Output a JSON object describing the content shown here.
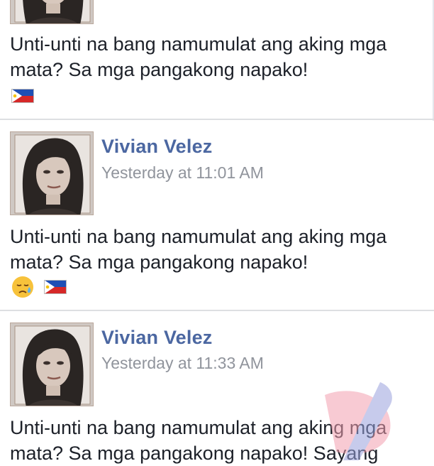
{
  "posts": [
    {
      "text": "Unti-unti na bang namumulat ang aking mga\nmata? Sa mga pangakong napako!",
      "emojis": [
        "philippines-flag"
      ]
    },
    {
      "author": "Vivian Velez",
      "timestamp": "Yesterday at 11:01 AM",
      "text": "Unti-unti na bang namumulat ang aking mga\nmata? Sa mga pangakong napako!",
      "emojis": [
        "sad-face-with-tear",
        "philippines-flag"
      ]
    },
    {
      "author": "Vivian Velez",
      "timestamp": "Yesterday at 11:33 AM",
      "text": "Unti-unti na bang namumulat ang aking mga\nmata? Sa mga pangakong napako! Sayang"
    }
  ],
  "colors": {
    "author": "#4b67a1",
    "timestamp": "#90949c",
    "divider": "#dddfe2"
  }
}
